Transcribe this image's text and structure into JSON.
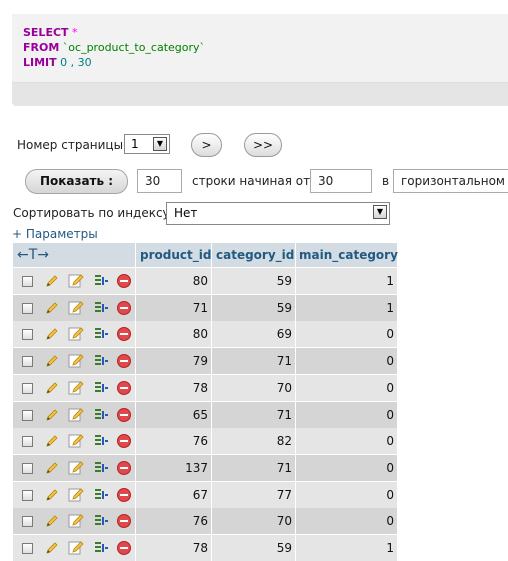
{
  "sql": {
    "line1_kw": "SELECT",
    "line1_op": "*",
    "line2_kw": "FROM",
    "line2_str": "`oc_product_to_category`",
    "line3_kw": "LIMIT",
    "line3_num": "0 , 30"
  },
  "pager": {
    "page_label": "Номер страницы:",
    "page_value": "1",
    "next_label": ">",
    "last_label": ">>"
  },
  "show": {
    "button_label": "Показать :",
    "rows_value": "30",
    "start_label": "строки начиная от",
    "start_value": "30",
    "in_label": "в",
    "mode_value": "горизонтальном"
  },
  "sort": {
    "label": "Сортировать по индексу:",
    "value": "Нет"
  },
  "options_link": "+ Параметры",
  "table": {
    "arrows": "←T→",
    "columns": [
      "product_id",
      "category_id",
      "main_category"
    ],
    "rows": [
      [
        "80",
        "59",
        "1"
      ],
      [
        "71",
        "59",
        "1"
      ],
      [
        "80",
        "69",
        "0"
      ],
      [
        "79",
        "71",
        "0"
      ],
      [
        "78",
        "70",
        "0"
      ],
      [
        "65",
        "71",
        "0"
      ],
      [
        "76",
        "82",
        "0"
      ],
      [
        "137",
        "71",
        "0"
      ],
      [
        "67",
        "77",
        "0"
      ],
      [
        "76",
        "70",
        "0"
      ],
      [
        "78",
        "59",
        "1"
      ]
    ]
  },
  "icons": [
    "checkbox",
    "pencil-icon",
    "inline-edit-icon",
    "copy-insert-icon",
    "delete-icon"
  ],
  "colors": {
    "header_bg": "#d3dce3",
    "header_text": "#235a81",
    "row_odd": "#e5e5e5",
    "row_even": "#d5d5d5",
    "keyword": "#990099"
  }
}
